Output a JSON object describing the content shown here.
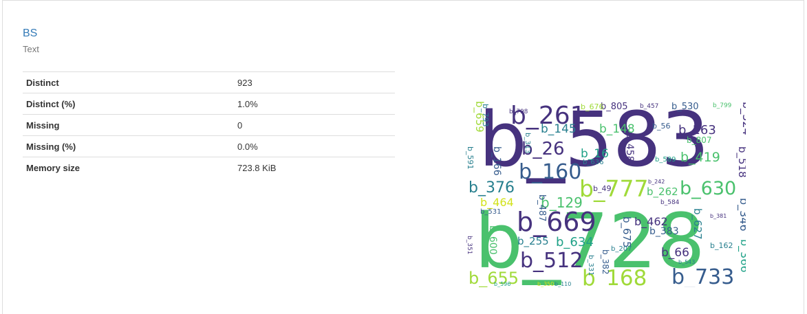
{
  "variable": {
    "name": "BS",
    "type": "Text"
  },
  "stats": [
    {
      "label": "Distinct",
      "value": "923"
    },
    {
      "label": "Distinct (%)",
      "value": "1.0%"
    },
    {
      "label": "Missing",
      "value": "0"
    },
    {
      "label": "Missing (%)",
      "value": "0.0%"
    },
    {
      "label": "Memory size",
      "value": "723.8 KiB"
    }
  ],
  "wordcloud": {
    "palette": [
      "#46327e",
      "#365c8d",
      "#277f8e",
      "#1fa187",
      "#4ac16d",
      "#a0da39",
      "#d2e21b"
    ],
    "words": [
      {
        "text": "b_583",
        "color": "#46327e"
      },
      {
        "text": "b_728",
        "color": "#4ac16d"
      },
      {
        "text": "b_669",
        "color": "#46327e"
      },
      {
        "text": "b_261",
        "color": "#46327e"
      },
      {
        "text": "b_160",
        "color": "#365c8d"
      },
      {
        "text": "b_777",
        "color": "#a0da39"
      },
      {
        "text": "b_630",
        "color": "#4ac16d"
      },
      {
        "text": "b_733",
        "color": "#365c8d"
      },
      {
        "text": "b_168",
        "color": "#a0da39"
      },
      {
        "text": "b_512",
        "color": "#46327e"
      },
      {
        "text": "b_655",
        "color": "#a0da39"
      },
      {
        "text": "b_26",
        "color": "#46327e"
      },
      {
        "text": "b_376",
        "color": "#277f8e"
      },
      {
        "text": "b_129",
        "color": "#4ac16d"
      },
      {
        "text": "b_634",
        "color": "#1fa187"
      },
      {
        "text": "b_163",
        "color": "#46327e"
      },
      {
        "text": "b_419",
        "color": "#4ac16d"
      },
      {
        "text": "b_148",
        "color": "#4ac16d"
      },
      {
        "text": "b_145",
        "color": "#277f8e"
      },
      {
        "text": "b_462",
        "color": "#46327e"
      },
      {
        "text": "b_464",
        "color": "#d2e21b"
      },
      {
        "text": "b_255",
        "color": "#277f8e"
      },
      {
        "text": "b_16",
        "color": "#1fa187"
      },
      {
        "text": "b_805",
        "color": "#46327e"
      },
      {
        "text": "b_530",
        "color": "#365c8d"
      },
      {
        "text": "b_676",
        "color": "#a0da39"
      },
      {
        "text": "b_262",
        "color": "#4ac16d"
      },
      {
        "text": "b_66",
        "color": "#46327e"
      },
      {
        "text": "b_383",
        "color": "#365c8d"
      },
      {
        "text": "b_324",
        "color": "#46327e"
      },
      {
        "text": "b_346",
        "color": "#365c8d"
      },
      {
        "text": "b_366",
        "color": "#1fa187"
      },
      {
        "text": "b_659",
        "color": "#a0da39"
      },
      {
        "text": "b_675",
        "color": "#365c8d"
      },
      {
        "text": "b_627",
        "color": "#277f8e"
      },
      {
        "text": "b_518",
        "color": "#46327e"
      },
      {
        "text": "b_600",
        "color": "#4ac16d"
      },
      {
        "text": "b_487",
        "color": "#365c8d"
      },
      {
        "text": "b_458",
        "color": "#46327e"
      },
      {
        "text": "b_166",
        "color": "#365c8d"
      },
      {
        "text": "b_382",
        "color": "#365c8d"
      },
      {
        "text": "b_807",
        "color": "#4ac16d"
      },
      {
        "text": "b_591",
        "color": "#277f8e"
      },
      {
        "text": "b_56",
        "color": "#365c8d"
      },
      {
        "text": "b_636",
        "color": "#277f8e"
      },
      {
        "text": "b_589",
        "color": "#1fa187"
      },
      {
        "text": "b_584",
        "color": "#46327e"
      },
      {
        "text": "b_49",
        "color": "#46327e"
      },
      {
        "text": "b_207",
        "color": "#277f8e"
      },
      {
        "text": "b_110",
        "color": "#277f8e"
      },
      {
        "text": "b_162",
        "color": "#277f8e"
      },
      {
        "text": "b_799",
        "color": "#4ac16d"
      },
      {
        "text": "b_457",
        "color": "#46327e"
      },
      {
        "text": "b_798",
        "color": "#46327e"
      },
      {
        "text": "b_793",
        "color": "#277f8e"
      },
      {
        "text": "b_313",
        "color": "#277f8e"
      },
      {
        "text": "b_242",
        "color": "#46327e"
      },
      {
        "text": "b_381",
        "color": "#46327e"
      },
      {
        "text": "b_543",
        "color": "#277f8e"
      },
      {
        "text": "b_331",
        "color": "#277f8e"
      },
      {
        "text": "b_351",
        "color": "#46327e"
      },
      {
        "text": "b_596",
        "color": "#1fa187"
      },
      {
        "text": "b_350",
        "color": "#d2e21b"
      },
      {
        "text": "b_531",
        "color": "#365c8d"
      }
    ]
  }
}
